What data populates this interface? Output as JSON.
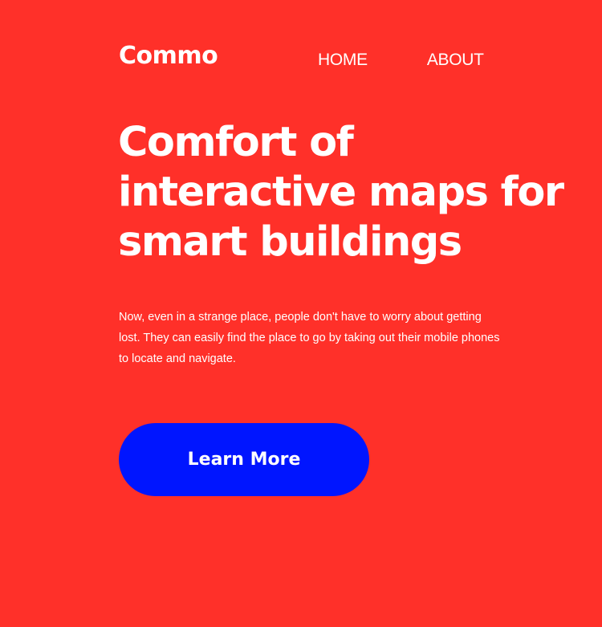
{
  "brand": {
    "name": "Commo"
  },
  "nav": {
    "items": [
      {
        "label": "HOME"
      },
      {
        "label": "ABOUT"
      }
    ]
  },
  "hero": {
    "headline": "Comfort of interactive maps for smart buildings",
    "description": "Now, even in a strange place, people don't have to worry about getting lost. They can easily find the place to go by taking out their mobile phones to locate and navigate.",
    "cta_label": "Learn More"
  },
  "colors": {
    "background": "#ff3029",
    "cta_background": "#0015ff",
    "text": "#ffffff"
  }
}
